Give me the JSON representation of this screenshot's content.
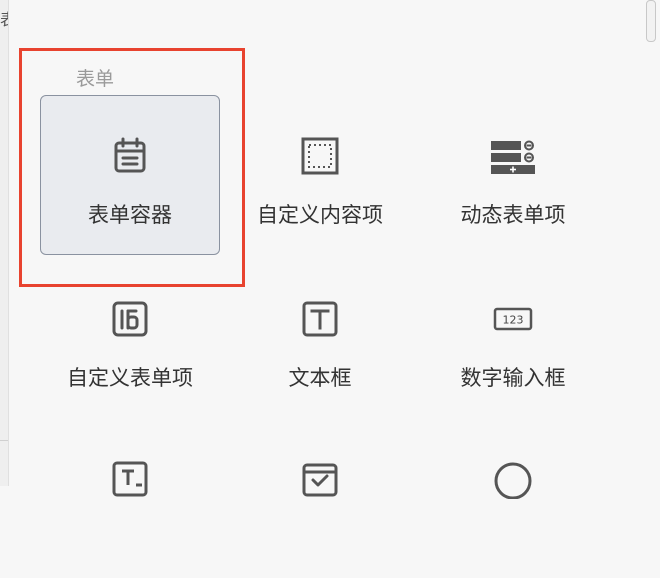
{
  "left_stub_text": "表",
  "section": {
    "title": "表单"
  },
  "items": [
    {
      "label": "表单容器",
      "icon": "calendar-form-icon"
    },
    {
      "label": "自定义内容项",
      "icon": "dashed-square-icon"
    },
    {
      "label": "动态表单项",
      "icon": "dynamic-list-icon"
    },
    {
      "label": "自定义表单项",
      "icon": "custom-form-item-icon"
    },
    {
      "label": "文本框",
      "icon": "text-box-icon"
    },
    {
      "label": "数字输入框",
      "icon": "number-input-icon"
    }
  ],
  "partial_icons": [
    {
      "icon": "text-area-icon"
    },
    {
      "icon": "date-picker-icon"
    },
    {
      "icon": "radio-icon"
    }
  ],
  "number_input_text": "123",
  "colors": {
    "highlight": "#e8432f",
    "selected_bg": "#e9ebef",
    "icon": "#555555"
  }
}
